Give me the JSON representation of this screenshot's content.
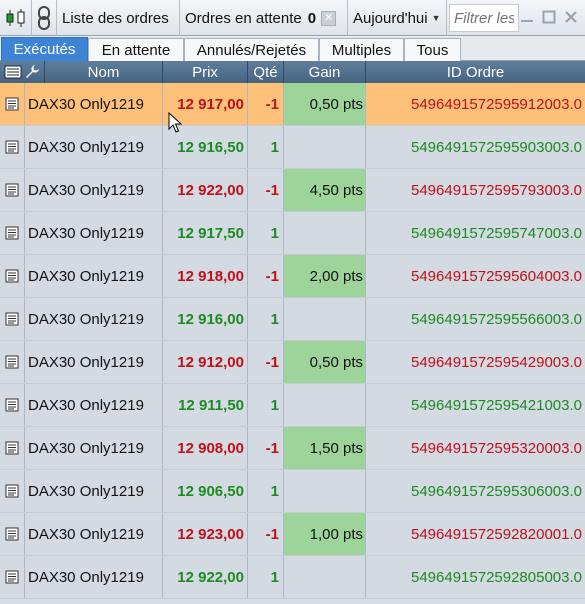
{
  "toolbar": {
    "list_label": "Liste des ordres",
    "pending_label": "Ordres en attente",
    "pending_count": "0",
    "period_label": "Aujourd'hui",
    "filter_placeholder": "Filtrer les ordres"
  },
  "tabs": [
    {
      "label": "Exécutés",
      "active": true
    },
    {
      "label": "En attente"
    },
    {
      "label": "Annulés/Rejetés"
    },
    {
      "label": "Multiples"
    },
    {
      "label": "Tous"
    }
  ],
  "columns": {
    "name": "Nom",
    "price": "Prix",
    "qty": "Qté",
    "gain": "Gain",
    "order_id": "ID Ordre"
  },
  "rows": [
    {
      "name": "DAX30 Only1219",
      "price": "12 917,00",
      "qty": "-1",
      "gain": "0,50 pts",
      "order_id": "5496491572595912003.0",
      "side": "sell",
      "selected": true
    },
    {
      "name": "DAX30 Only1219",
      "price": "12 916,50",
      "qty": "1",
      "gain": "",
      "order_id": "5496491572595903003.0",
      "side": "buy"
    },
    {
      "name": "DAX30 Only1219",
      "price": "12 922,00",
      "qty": "-1",
      "gain": "4,50 pts",
      "order_id": "5496491572595793003.0",
      "side": "sell"
    },
    {
      "name": "DAX30 Only1219",
      "price": "12 917,50",
      "qty": "1",
      "gain": "",
      "order_id": "5496491572595747003.0",
      "side": "buy"
    },
    {
      "name": "DAX30 Only1219",
      "price": "12 918,00",
      "qty": "-1",
      "gain": "2,00 pts",
      "order_id": "5496491572595604003.0",
      "side": "sell"
    },
    {
      "name": "DAX30 Only1219",
      "price": "12 916,00",
      "qty": "1",
      "gain": "",
      "order_id": "5496491572595566003.0",
      "side": "buy"
    },
    {
      "name": "DAX30 Only1219",
      "price": "12 912,00",
      "qty": "-1",
      "gain": "0,50 pts",
      "order_id": "5496491572595429003.0",
      "side": "sell"
    },
    {
      "name": "DAX30 Only1219",
      "price": "12 911,50",
      "qty": "1",
      "gain": "",
      "order_id": "5496491572595421003.0",
      "side": "buy"
    },
    {
      "name": "DAX30 Only1219",
      "price": "12 908,00",
      "qty": "-1",
      "gain": "1,50 pts",
      "order_id": "5496491572595320003.0",
      "side": "sell"
    },
    {
      "name": "DAX30 Only1219",
      "price": "12 906,50",
      "qty": "1",
      "gain": "",
      "order_id": "5496491572595306003.0",
      "side": "buy"
    },
    {
      "name": "DAX30 Only1219",
      "price": "12 923,00",
      "qty": "-1",
      "gain": "1,00 pts",
      "order_id": "5496491572592820001.0",
      "side": "sell"
    },
    {
      "name": "DAX30 Only1219",
      "price": "12 922,00",
      "qty": "1",
      "gain": "",
      "order_id": "5496491572592805003.0",
      "side": "buy"
    }
  ],
  "colors": {
    "buy": "#1d8a22",
    "sell": "#c0101a",
    "selected_row": "#fdc17a",
    "gain_cell": "#9dd49a",
    "active_tab": "#3d84d6"
  },
  "icons": {
    "chart": "candlestick-chart-icon",
    "link": "chain-link-icon",
    "clear": "clear-x-icon",
    "period_dropdown": "caret-down-icon",
    "minimize": "minimize-icon",
    "maximize": "maximize-icon",
    "close": "close-icon",
    "columns": "columns-list-icon",
    "settings": "wrench-icon",
    "row_detail": "document-icon"
  }
}
